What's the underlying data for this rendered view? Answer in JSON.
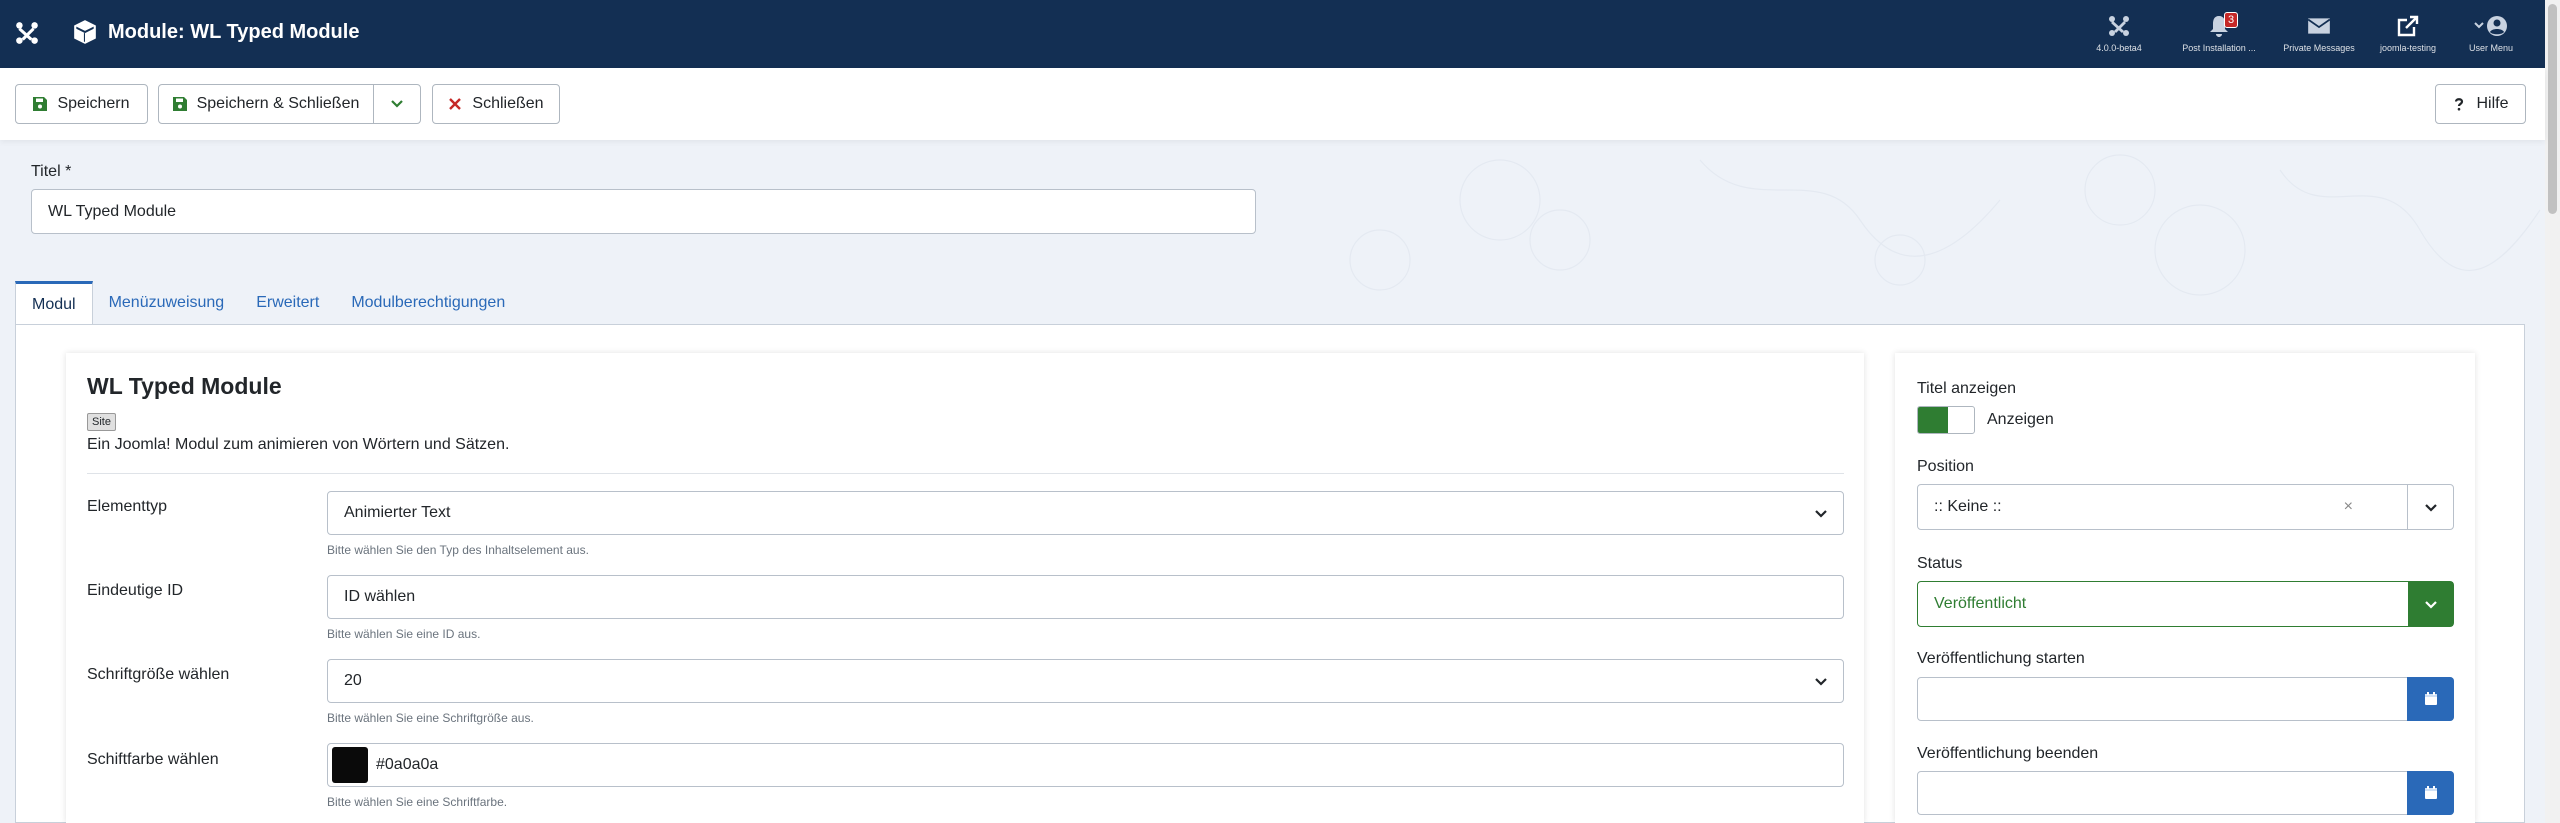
{
  "header": {
    "title": "Module: WL Typed Module",
    "items": [
      {
        "label": "4.0.0-beta4",
        "icon": "joomla-icon"
      },
      {
        "label": "Post Installation ...",
        "icon": "bell-icon",
        "badge": "3"
      },
      {
        "label": "Private Messages",
        "icon": "envelope-icon"
      },
      {
        "label": "joomla-testing",
        "icon": "external-link-icon"
      },
      {
        "label": "User Menu",
        "icon": "user-icon"
      }
    ]
  },
  "toolbar": {
    "save_label": "Speichern",
    "save_close_label": "Speichern & Schließen",
    "close_label": "Schließen",
    "help_label": "Hilfe"
  },
  "title_field": {
    "label": "Titel *",
    "value": "WL Typed Module"
  },
  "tabs": [
    "Modul",
    "Menüzuweisung",
    "Erweitert",
    "Modulberechtigungen"
  ],
  "module": {
    "name": "WL Typed Module",
    "badge": "Site",
    "description": "Ein Joomla! Modul zum animieren von Wörtern und Sätzen."
  },
  "fields": {
    "element_type": {
      "label": "Elementtyp",
      "value": "Animierter Text",
      "help": "Bitte wählen Sie den Typ des Inhaltselement aus."
    },
    "unique_id": {
      "label": "Eindeutige ID",
      "value": "ID wählen",
      "help": "Bitte wählen Sie eine ID aus."
    },
    "font_size": {
      "label": "Schriftgröße wählen",
      "value": "20",
      "help": "Bitte wählen Sie eine Schriftgröße aus."
    },
    "font_color": {
      "label": "Schiftfarbe wählen",
      "value": "#0a0a0a",
      "help": "Bitte wählen Sie eine Schriftfarbe."
    }
  },
  "sidebar": {
    "show_title_label": "Titel anzeigen",
    "show_title_value": "Anzeigen",
    "position_label": "Position",
    "position_value": ":: Keine ::",
    "position_clear": "×",
    "status_label": "Status",
    "status_value": "Veröffentlicht",
    "publish_up_label": "Veröffentlichung starten",
    "publish_down_label": "Veröffentlichung beenden"
  },
  "colors": {
    "header_bg": "#132f53",
    "accent": "#2a69b8",
    "success": "#2f7d32",
    "danger": "#c52827"
  }
}
